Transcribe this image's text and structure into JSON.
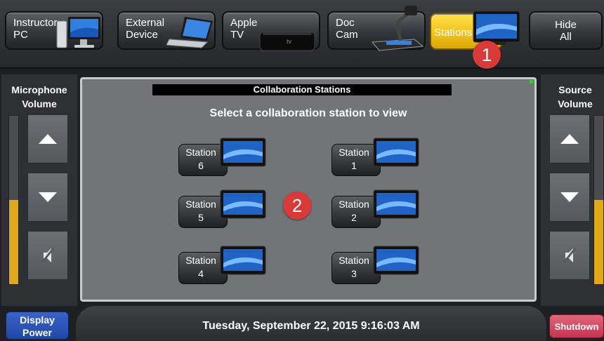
{
  "sources": [
    {
      "label": "Instructor\nPC",
      "icon": "pc-monitor-icon"
    },
    {
      "label": "External\nDevice",
      "icon": "laptop-icon"
    },
    {
      "label": "Apple\nTV",
      "icon": "apple-tv-icon"
    },
    {
      "label": "Doc\nCam",
      "icon": "document-camera-icon"
    },
    {
      "label": "Stations",
      "icon": "monitor-icon",
      "active": true
    },
    {
      "label": "Hide\nAll"
    }
  ],
  "badges": [
    "1",
    "2"
  ],
  "microphone": {
    "title": "Microphone\nVolume",
    "level": 0.5
  },
  "source_volume": {
    "title": "Source\nVolume",
    "level": 0.5
  },
  "center": {
    "title": "Collaboration Stations",
    "subtitle": "Select a collaboration station to view",
    "stations": [
      {
        "label": "Station",
        "number": "6"
      },
      {
        "label": "Station",
        "number": "1"
      },
      {
        "label": "Station",
        "number": "5"
      },
      {
        "label": "Station",
        "number": "2"
      },
      {
        "label": "Station",
        "number": "4"
      },
      {
        "label": "Station",
        "number": "3"
      }
    ]
  },
  "footer": {
    "display_power": "Display\nPower",
    "datetime": "Tuesday, September 22, 2015 9:16:03 AM",
    "shutdown": "Shutdown"
  },
  "colors": {
    "active_source": "#f1c018",
    "volume_fill": "#e0a81a",
    "badge": "#d83a3a",
    "display_power": "#2a55b8",
    "shutdown": "#d24560"
  }
}
